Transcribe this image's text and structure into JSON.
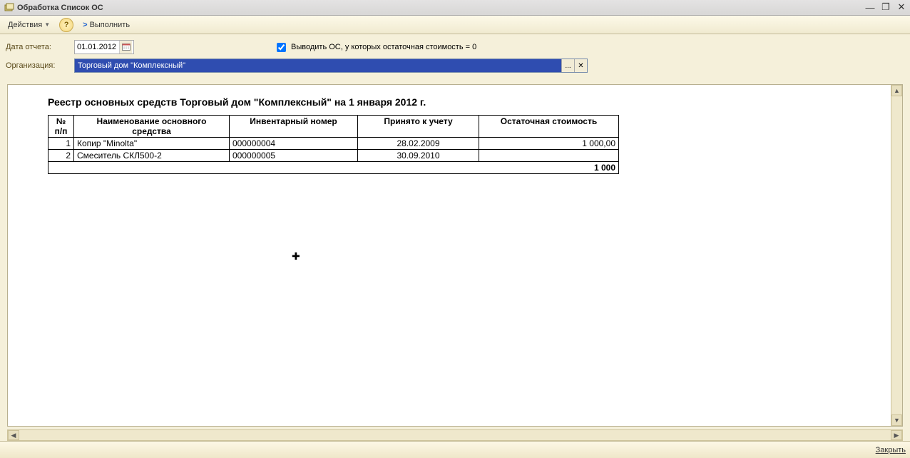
{
  "window": {
    "title": "Обработка  Список ОС"
  },
  "toolbar": {
    "actions_label": "Действия",
    "execute_label": "Выполнить"
  },
  "filters": {
    "date_label": "Дата отчета:",
    "date_value": "01.01.2012",
    "output_zero_label": "Выводить ОС, у которых остаточная стоимость = 0",
    "output_zero_checked": true,
    "org_label": "Организация:",
    "org_value": "Торговый дом \"Комплексный\""
  },
  "report": {
    "title": "Реестр основных средств Торговый дом \"Комплексный\" на 1 января 2012 г.",
    "columns": {
      "num": "№ п/п",
      "name": "Наименование основного средства",
      "inv": "Инвентарный номер",
      "date": "Принято к учету",
      "cost": "Остаточная стоимость"
    },
    "rows": [
      {
        "num": "1",
        "name": "Копир \"Minolta\"",
        "inv": "000000004",
        "date": "28.02.2009",
        "cost": "1 000,00"
      },
      {
        "num": "2",
        "name": "Смеситель СКЛ500-2",
        "inv": "000000005",
        "date": "30.09.2010",
        "cost": ""
      }
    ],
    "total": "1 000"
  },
  "footer": {
    "close_label": "Закрыть"
  }
}
